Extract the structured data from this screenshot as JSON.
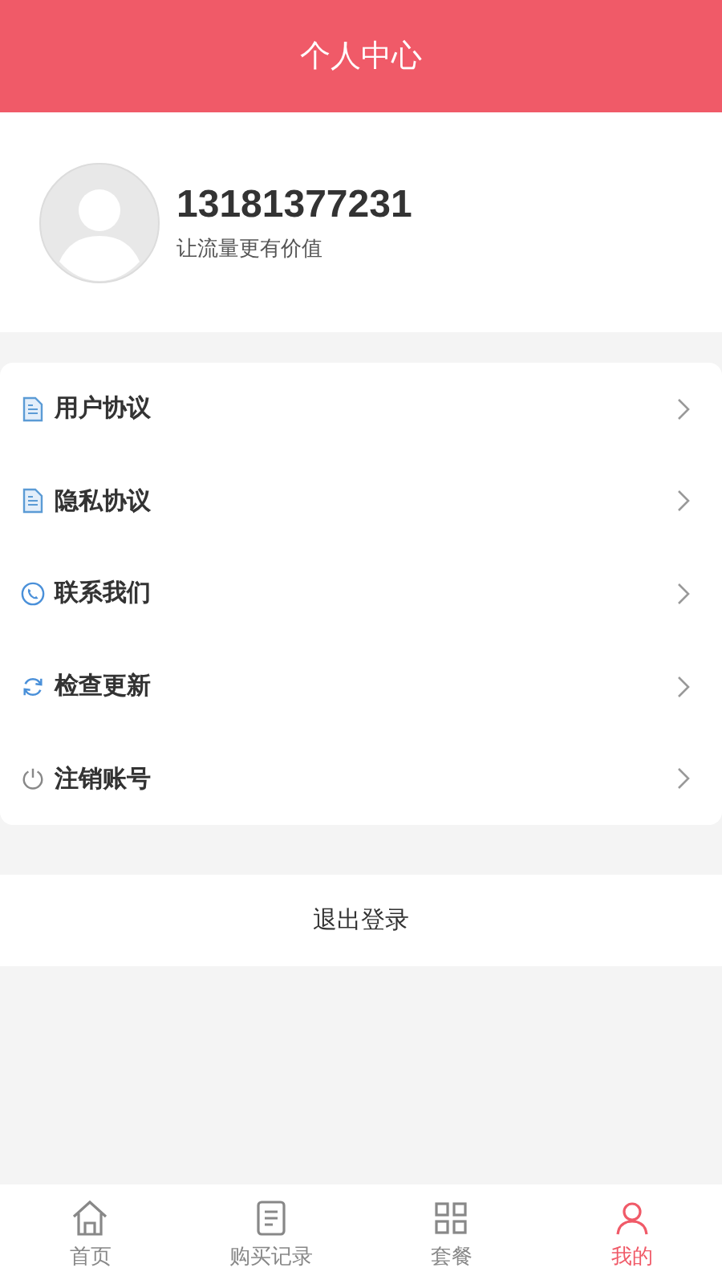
{
  "header": {
    "title": "个人中心"
  },
  "profile": {
    "phone": "13181377231",
    "tagline": "让流量更有价值"
  },
  "menu": [
    {
      "kind": "document",
      "label": "用户协议"
    },
    {
      "kind": "document",
      "label": "隐私协议"
    },
    {
      "kind": "phone",
      "label": "联系我们"
    },
    {
      "kind": "refresh",
      "label": "检查更新"
    },
    {
      "kind": "power",
      "label": "注销账号"
    }
  ],
  "logout": {
    "label": "退出登录"
  },
  "tabs": [
    {
      "kind": "home",
      "label": "首页",
      "selected": false
    },
    {
      "kind": "list",
      "label": "购买记录",
      "selected": false
    },
    {
      "kind": "grid",
      "label": "套餐",
      "selected": false
    },
    {
      "kind": "user",
      "label": "我的",
      "selected": true
    }
  ]
}
